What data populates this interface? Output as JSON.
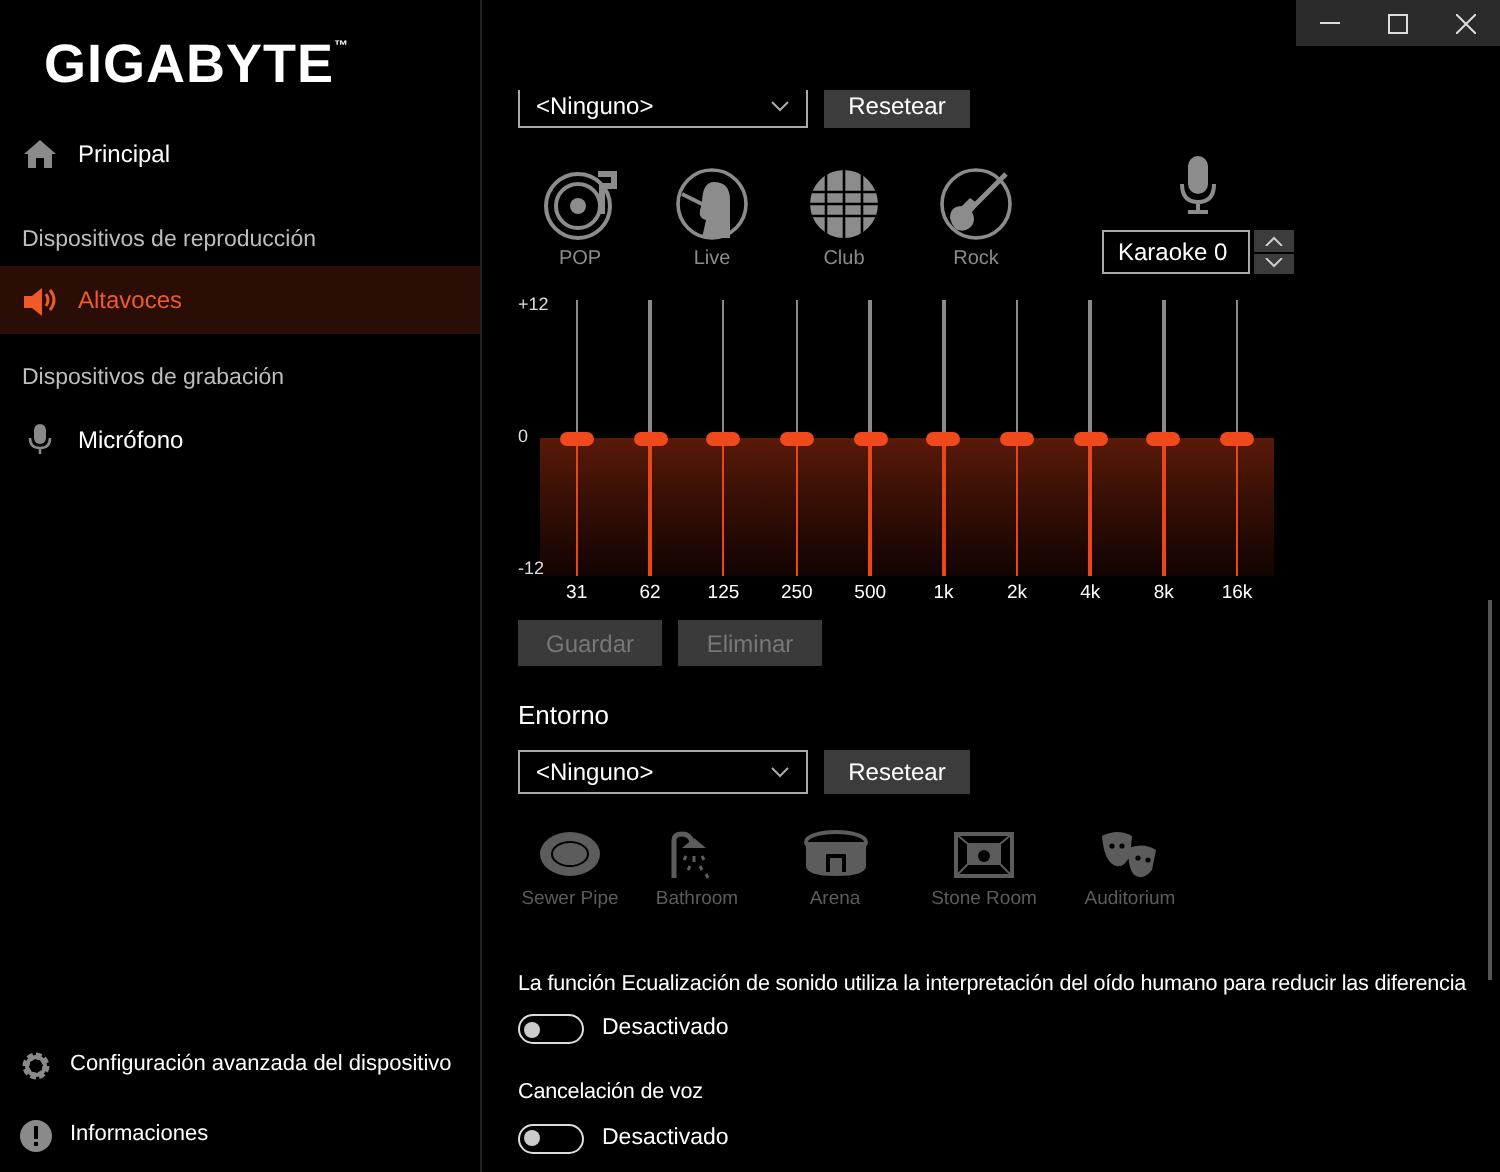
{
  "logo": {
    "text": "GIGABYTE",
    "mark": "™"
  },
  "sidebar": {
    "top": [
      {
        "kind": "item",
        "label": "Principal",
        "selected": false
      },
      {
        "kind": "header",
        "label": "Dispositivos de reproducción"
      },
      {
        "kind": "item",
        "label": "Altavoces",
        "selected": true
      },
      {
        "kind": "header",
        "label": "Dispositivos de grabación"
      },
      {
        "kind": "item",
        "label": "Micrófono",
        "selected": false
      }
    ],
    "bottom": [
      {
        "label": "Configuración avanzada del dispositivo"
      },
      {
        "label": "Informaciones"
      }
    ]
  },
  "equalizer_preset": {
    "value": "<Ninguno>",
    "button": "Resetear"
  },
  "presets": [
    {
      "label": "POP",
      "disabled": false
    },
    {
      "label": "Live",
      "disabled": false
    },
    {
      "label": "Club",
      "disabled": false
    },
    {
      "label": "Rock",
      "disabled": false
    }
  ],
  "karaoke": {
    "value": "Karaoke 0"
  },
  "eq": {
    "scale": [
      "+12",
      "0",
      "-12"
    ],
    "bands": [
      {
        "label": "31",
        "level": 0.5
      },
      {
        "label": "62",
        "level": 0.5
      },
      {
        "label": "125",
        "level": 0.5
      },
      {
        "label": "250",
        "level": 0.5
      },
      {
        "label": "500",
        "level": 0.5
      },
      {
        "label": "1k",
        "level": 0.5
      },
      {
        "label": "2k",
        "level": 0.5
      },
      {
        "label": "4k",
        "level": 0.5
      },
      {
        "label": "8k",
        "level": 0.5
      },
      {
        "label": "16k",
        "level": 0.5
      }
    ]
  },
  "eq_buttons": [
    {
      "label": "Guardar",
      "disabled": true
    },
    {
      "label": "Eliminar",
      "disabled": true
    }
  ],
  "environment": {
    "title": "Entorno",
    "value": "<Ninguno>",
    "button": "Resetear",
    "items": [
      {
        "label": "Sewer Pipe",
        "disabled": true
      },
      {
        "label": "Bathroom",
        "disabled": true
      },
      {
        "label": "Arena",
        "disabled": true
      },
      {
        "label": "Stone Room",
        "disabled": true
      },
      {
        "label": "Auditorium",
        "disabled": true
      }
    ]
  },
  "settings": [
    {
      "label": "La función Ecualización de sonido utiliza la interpretación del oído humano para reducir las diferencia",
      "state_label": "Desactivado",
      "on": false
    },
    {
      "label": "Cancelación de voz",
      "state_label": "Desactivado",
      "on": false
    }
  ]
}
